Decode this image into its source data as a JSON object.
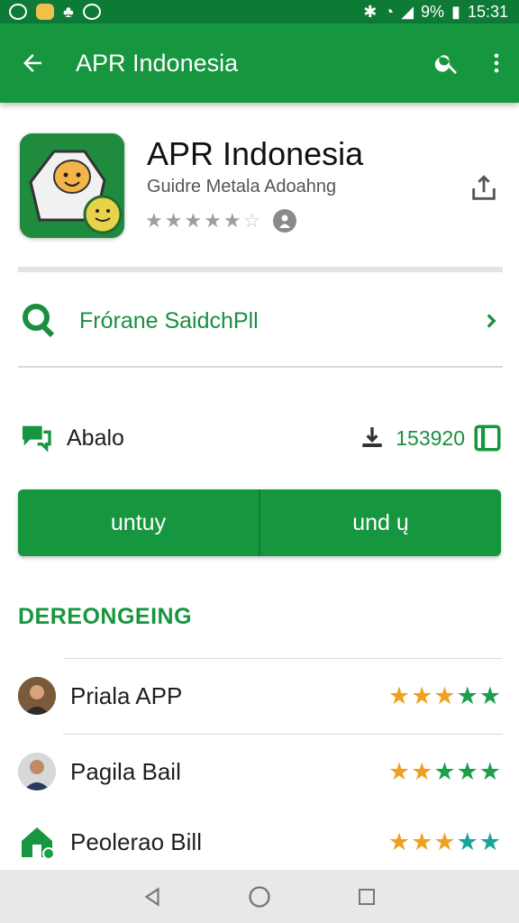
{
  "status_bar": {
    "battery": "9%",
    "time": "15:31"
  },
  "toolbar": {
    "title": "APR Indonesia",
    "back_icon": "arrow-left-icon",
    "search_icon": "search-icon",
    "menu_icon": "more-vert-icon"
  },
  "app": {
    "title": "APR Indonesia",
    "subtitle": "Guidre Metala Adoahng",
    "stars_filled": 5,
    "stars_total": 6
  },
  "feature": {
    "label": "Frórane SaidchPll"
  },
  "info": {
    "label": "Abalo",
    "count": "153920"
  },
  "buttons": {
    "left_label": "untuy",
    "right_label": "und ų"
  },
  "section": {
    "title": "DEREONGEING"
  },
  "reviews": [
    {
      "name": "Priala APP",
      "stars": [
        "orange",
        "orange",
        "orange",
        "green",
        "green"
      ]
    },
    {
      "name": "Pagila Bail",
      "stars": [
        "orange",
        "orange",
        "green",
        "green",
        "green"
      ]
    },
    {
      "name": "Peolerao Bill",
      "stars": [
        "orange",
        "orange",
        "orange",
        "teal",
        "teal"
      ]
    }
  ],
  "colors": {
    "primary": "#16963f",
    "status_bar": "#0d7a36",
    "accent_text": "#1a8f3f",
    "star_orange": "#f0a020",
    "star_green": "#1aa04a"
  }
}
